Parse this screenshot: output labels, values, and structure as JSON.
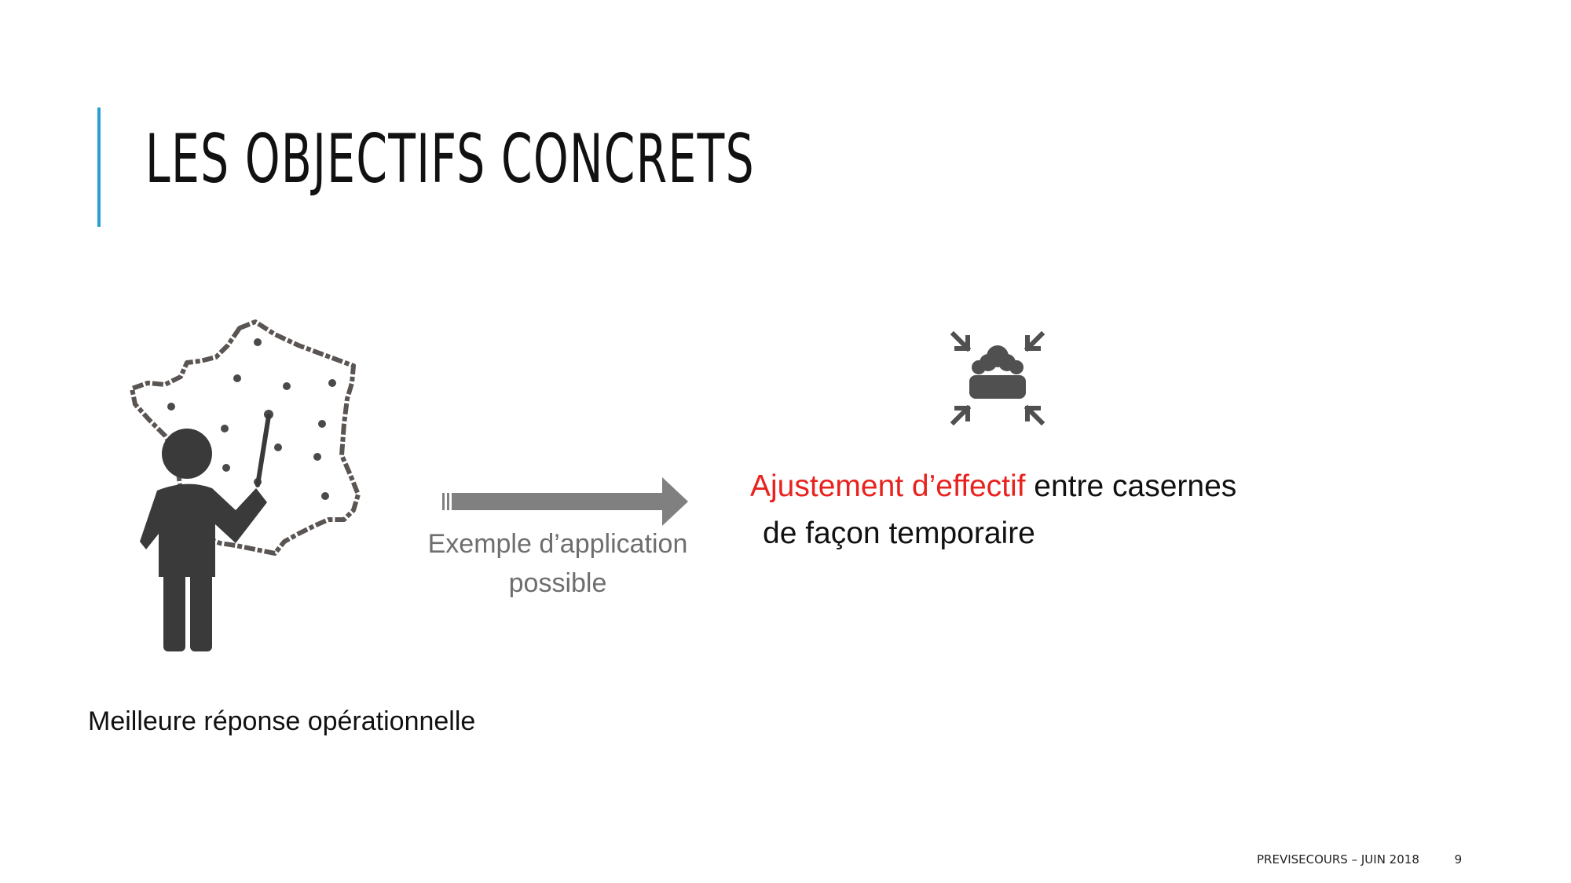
{
  "slide": {
    "title": "LES OBJECTIFS CONCRETS",
    "accent_color": "#2a9fd0",
    "highlight_color": "#e8231f"
  },
  "left": {
    "icon": "presenter-map-icon",
    "caption": "Meilleure réponse opérationnelle"
  },
  "arrow": {
    "icon": "right-arrow-icon",
    "caption_line1": "Exemple d’application",
    "caption_line2": "possible"
  },
  "right": {
    "icon": "group-gather-icon",
    "highlight_text": "Ajustement d’effectif",
    "text_rest": " entre casernes",
    "line2": "de façon temporaire"
  },
  "footer": {
    "label": "PREVISECOURS – JUIN 2018",
    "page_number": "9"
  }
}
